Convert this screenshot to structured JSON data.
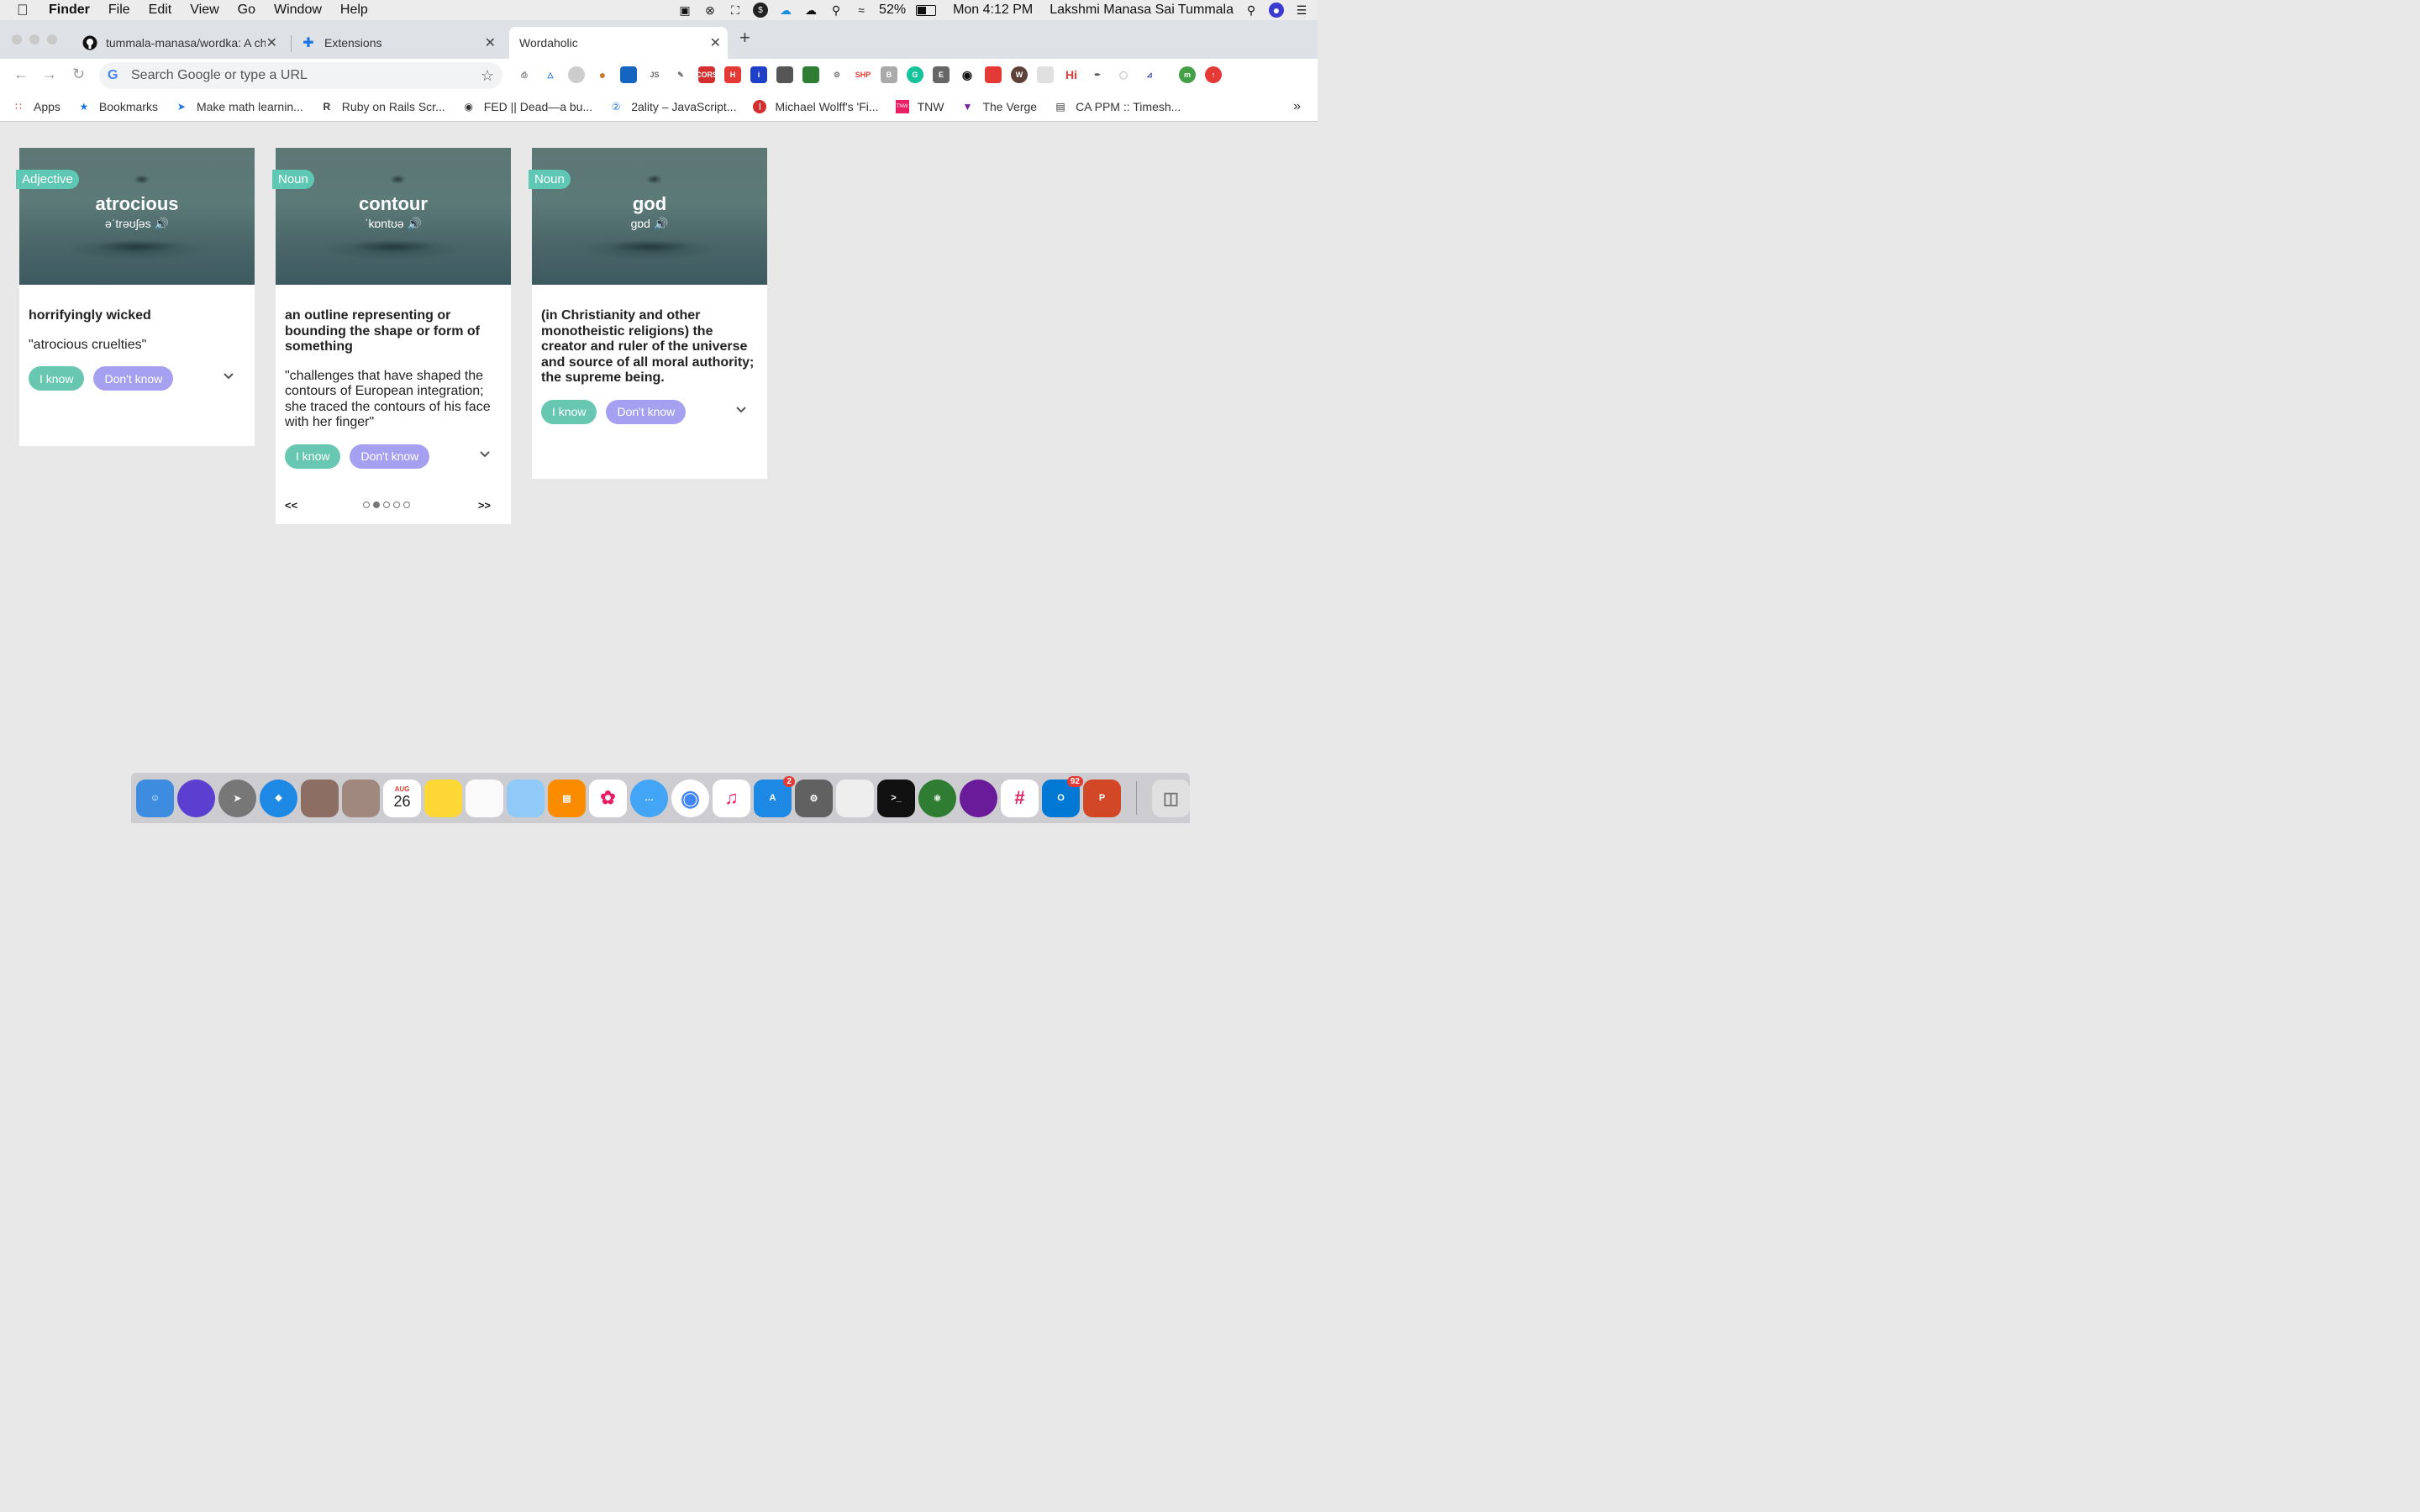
{
  "menubar": {
    "app": "Finder",
    "items": [
      "File",
      "Edit",
      "View",
      "Go",
      "Window",
      "Help"
    ],
    "battery": "52%",
    "clock": "Mon 4:12 PM",
    "user": "Lakshmi Manasa Sai Tummala"
  },
  "tabs": [
    {
      "title": "tummala-manasa/wordka: A ch",
      "icon": "github-icon"
    },
    {
      "title": "Extensions",
      "icon": "puzzle-icon"
    },
    {
      "title": "Wordaholic",
      "icon": ""
    }
  ],
  "omnibox": {
    "placeholder": "Search Google or type a URL"
  },
  "bookmarks": [
    {
      "label": "Apps",
      "icon": "apps-grid-icon"
    },
    {
      "label": "Bookmarks",
      "icon": "star-icon"
    },
    {
      "label": "Make math learnin...",
      "icon": "rocket-icon"
    },
    {
      "label": "Ruby on Rails Scr...",
      "icon": "r-logo-icon"
    },
    {
      "label": "FED || Dead—a bu...",
      "icon": "globe-icon"
    },
    {
      "label": "2ality – JavaScript...",
      "icon": "two-circle-icon"
    },
    {
      "label": "Michael Wolff's 'Fi...",
      "icon": "i-red-icon"
    },
    {
      "label": "TNW",
      "icon": "tnw-icon"
    },
    {
      "label": "The Verge",
      "icon": "verge-icon"
    },
    {
      "label": "CA PPM :: Timesh...",
      "icon": "ca-icon"
    }
  ],
  "cards": [
    {
      "pos": "Adjective",
      "word": "atrocious",
      "phonetic": "əˈtrəʊʃəs",
      "definition": "horrifyingly wicked",
      "example": "\"atrocious cruelties\"",
      "know": "I know",
      "dont_know": "Don't know"
    },
    {
      "pos": "Noun",
      "word": "contour",
      "phonetic": "ˈkɒntʊə",
      "definition": "an outline representing or bounding the shape or form of something",
      "example": "\"challenges that have shaped the contours of European integration; she traced the contours of his face with her finger\"",
      "know": "I know",
      "dont_know": "Don't know",
      "prev": "<<",
      "next": ">>"
    },
    {
      "pos": "Noun",
      "word": "god",
      "phonetic": "gɒd",
      "definition": "(in Christianity and other monotheistic religions) the creator and ruler of the universe and source of all moral authority; the supreme being.",
      "know": "I know",
      "dont_know": "Don't know"
    }
  ],
  "pager": {
    "current_index": 1,
    "total": 5
  },
  "dock": {
    "calendar_month": "AUG",
    "calendar_day": "26",
    "appstore_badge": "2",
    "outlook_badge": "92"
  }
}
